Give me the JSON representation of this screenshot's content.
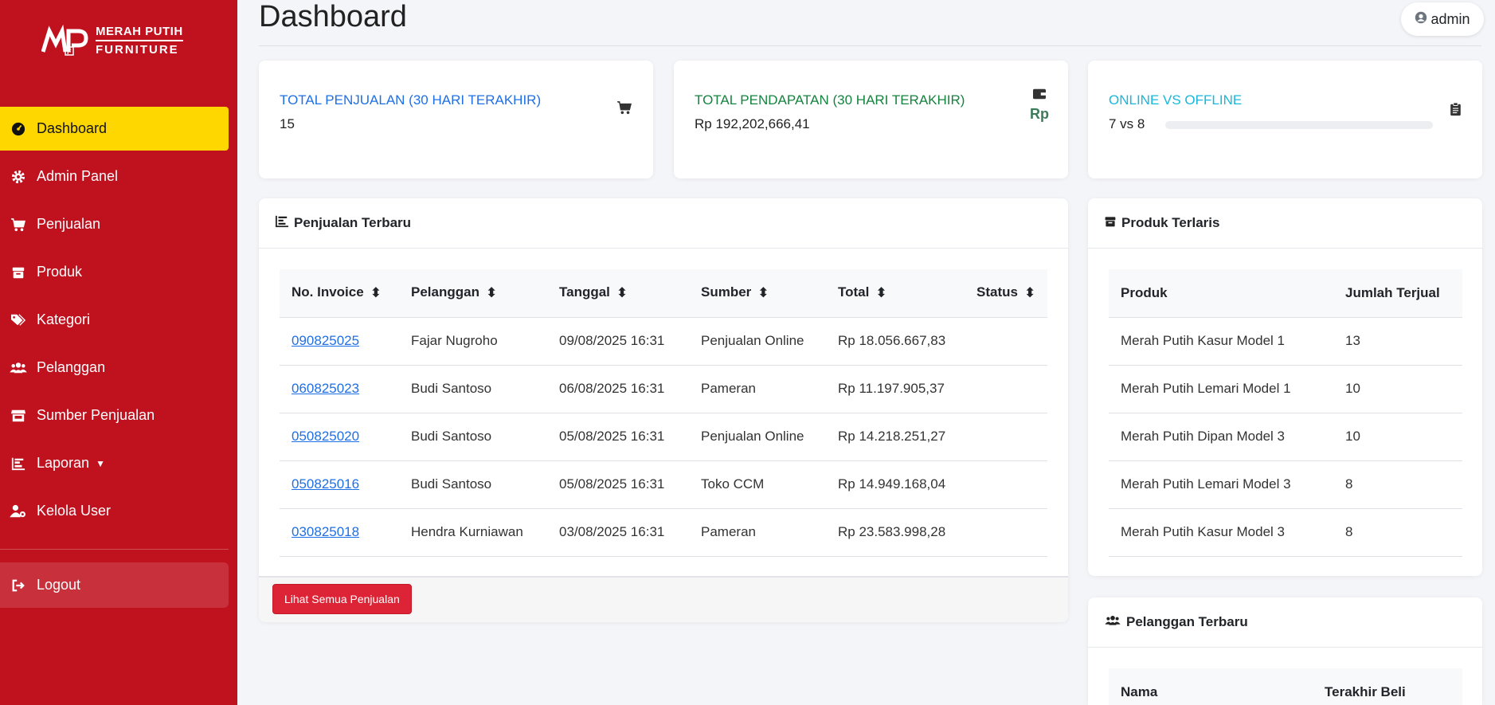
{
  "brand": {
    "line1": "MERAH PUTIH",
    "line2": "FURNITURE"
  },
  "sidebar": {
    "items": [
      {
        "label": "Dashboard",
        "icon": "dashboard-icon",
        "active": true
      },
      {
        "label": "Admin Panel",
        "icon": "gear-icon"
      },
      {
        "label": "Penjualan",
        "icon": "cart-icon"
      },
      {
        "label": "Produk",
        "icon": "box-icon"
      },
      {
        "label": "Kategori",
        "icon": "tags-icon"
      },
      {
        "label": "Pelanggan",
        "icon": "users-icon"
      },
      {
        "label": "Sumber Penjualan",
        "icon": "store-icon"
      },
      {
        "label": "Laporan",
        "icon": "chart-icon",
        "dropdown": true
      },
      {
        "label": "Kelola User",
        "icon": "user-gear-icon"
      }
    ],
    "logout": "Logout"
  },
  "header": {
    "title": "Dashboard",
    "user": "admin"
  },
  "stats": [
    {
      "label": "TOTAL PENJUALAN (30 HARI TERAKHIR)",
      "value": "15",
      "color": "#1f6fe5",
      "icon": "cart-icon"
    },
    {
      "label": "TOTAL PENDAPATAN (30 HARI TERAKHIR)",
      "value": "Rp 192,202,666,41",
      "color": "#15833f",
      "icon": "wallet-icon",
      "icon_text": "Rp"
    },
    {
      "label": "ONLINE VS OFFLINE",
      "value": "7 vs 8",
      "color": "#16b8dc",
      "icon": "clipboard-icon",
      "progress": 0
    }
  ],
  "recent_sales": {
    "title": "Penjualan Terbaru",
    "columns": [
      "No. Invoice",
      "Pelanggan",
      "Tanggal",
      "Sumber",
      "Total",
      "Status"
    ],
    "rows": [
      [
        "090825025",
        "Fajar Nugroho",
        "09/08/2025 16:31",
        "Penjualan Online",
        "Rp 18.056.667,83",
        ""
      ],
      [
        "060825023",
        "Budi Santoso",
        "06/08/2025 16:31",
        "Pameran",
        "Rp 11.197.905,37",
        ""
      ],
      [
        "050825020",
        "Budi Santoso",
        "05/08/2025 16:31",
        "Penjualan Online",
        "Rp 14.218.251,27",
        ""
      ],
      [
        "050825016",
        "Budi Santoso",
        "05/08/2025 16:31",
        "Toko CCM",
        "Rp 14.949.168,04",
        ""
      ],
      [
        "030825018",
        "Hendra Kurniawan",
        "03/08/2025 16:31",
        "Pameran",
        "Rp 23.583.998,28",
        ""
      ]
    ],
    "button": "Lihat Semua Penjualan"
  },
  "top_products": {
    "title": "Produk Terlaris",
    "columns": [
      "Produk",
      "Jumlah Terjual"
    ],
    "rows": [
      [
        "Merah Putih Kasur Model 1",
        "13"
      ],
      [
        "Merah Putih Lemari Model 1",
        "10"
      ],
      [
        "Merah Putih Dipan Model 3",
        "10"
      ],
      [
        "Merah Putih Lemari Model 3",
        "8"
      ],
      [
        "Merah Putih Kasur Model 3",
        "8"
      ]
    ]
  },
  "recent_customers": {
    "title": "Pelanggan Terbaru",
    "columns": [
      "Nama",
      "Terakhir Beli"
    ]
  }
}
